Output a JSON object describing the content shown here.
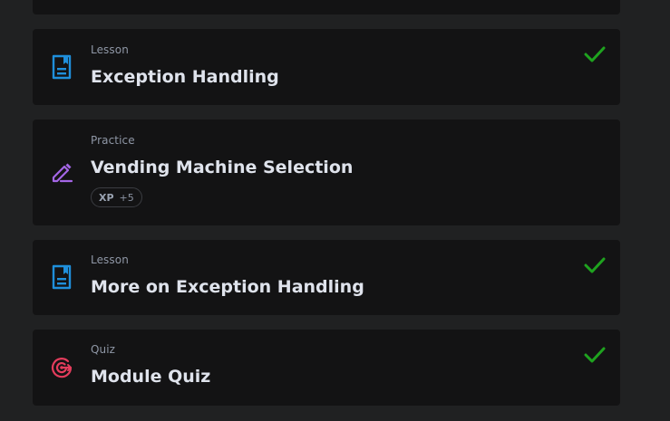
{
  "colors": {
    "background": "#202122",
    "card": "#131314",
    "lesson_icon": "#1f8fdb",
    "practice_icon": "#a466e6",
    "quiz_icon": "#e33c5c",
    "check": "#1fa31f"
  },
  "items": [
    {
      "kind": "Lesson",
      "title": "Exception Handling",
      "icon": "lesson-doc-icon",
      "completed": true
    },
    {
      "kind": "Practice",
      "title": "Vending Machine Selection",
      "icon": "pencil-icon",
      "completed": false,
      "xp_label": "XP",
      "xp_amount": "+5"
    },
    {
      "kind": "Lesson",
      "title": "More on Exception Handling",
      "icon": "lesson-doc-icon",
      "completed": true
    },
    {
      "kind": "Quiz",
      "title": "Module Quiz",
      "icon": "target-icon",
      "completed": true
    }
  ]
}
